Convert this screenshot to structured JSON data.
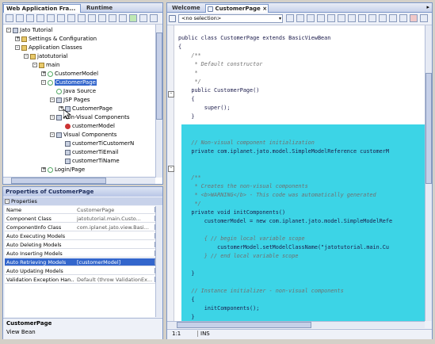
{
  "left_panel": {
    "tabs": [
      {
        "label": "Web Application Fra...",
        "active": true
      },
      {
        "label": "Runtime",
        "active": false
      }
    ],
    "tree": [
      {
        "label": "Jato Tutorial",
        "depth": 0,
        "icon": "project-icon",
        "expander": "-"
      },
      {
        "label": "Settings & Configuration",
        "depth": 1,
        "icon": "folder-icon",
        "expander": "+"
      },
      {
        "label": "Application Classes",
        "depth": 1,
        "icon": "folder-icon",
        "expander": "-"
      },
      {
        "label": "jatotutorial",
        "depth": 2,
        "icon": "package-icon",
        "expander": "-"
      },
      {
        "label": "main",
        "depth": 3,
        "icon": "package-icon",
        "expander": "-"
      },
      {
        "label": "CustomerModel",
        "depth": 4,
        "icon": "class-icon",
        "expander": "+"
      },
      {
        "label": "CustomerPage",
        "depth": 4,
        "icon": "class-icon",
        "expander": "-",
        "selected": true
      },
      {
        "label": "Java Source",
        "depth": 5,
        "icon": "source-icon",
        "expander": ""
      },
      {
        "label": "JSP Pages",
        "depth": 5,
        "icon": "group-icon",
        "expander": "-"
      },
      {
        "label": "CustomerPage",
        "depth": 6,
        "icon": "jsp-icon",
        "expander": "+"
      },
      {
        "label": "Non-Visual Components",
        "depth": 5,
        "icon": "group-icon",
        "expander": "-"
      },
      {
        "label": "customerModel",
        "depth": 6,
        "icon": "bean-icon",
        "expander": ""
      },
      {
        "label": "Visual Components",
        "depth": 5,
        "icon": "group-icon",
        "expander": "-"
      },
      {
        "label": "customerTiCustomerN",
        "depth": 6,
        "icon": "field-icon",
        "expander": ""
      },
      {
        "label": "customerTiEmail",
        "depth": 6,
        "icon": "field-icon",
        "expander": ""
      },
      {
        "label": "customerTiName",
        "depth": 6,
        "icon": "field-icon",
        "expander": ""
      },
      {
        "label": "Login/Page",
        "depth": 4,
        "icon": "class-icon",
        "expander": "+"
      }
    ]
  },
  "properties": {
    "title": "Properties of CustomerPage",
    "section": "Properties",
    "rows": [
      {
        "name": "Name",
        "value": "CustomerPage"
      },
      {
        "name": "Component Class",
        "value": "jatotutorial.main.Custo..."
      },
      {
        "name": "ComponentInfo Class",
        "value": "com.iplanet.jato.view.Basi..."
      },
      {
        "name": "Auto Executing Models",
        "value": ""
      },
      {
        "name": "Auto Deleting Models",
        "value": ""
      },
      {
        "name": "Auto Inserting Models",
        "value": ""
      },
      {
        "name": "Auto Retrieving Models",
        "value": "[customerModel]",
        "selected": true
      },
      {
        "name": "Auto Updating Models",
        "value": ""
      },
      {
        "name": "Validation Exception Han...",
        "value": "Default (throw ValidationEx..."
      }
    ],
    "footer_title": "CustomerPage",
    "footer_sub": "View Bean"
  },
  "editor": {
    "tabs": [
      {
        "label": "Welcome",
        "active": false
      },
      {
        "label": "CustomerPage",
        "active": true
      }
    ],
    "selector_value": "<no selection>",
    "code": [
      {
        "text": "public class CustomerPage extends BasicViewBean",
        "type": "code"
      },
      {
        "text": "{",
        "type": "code"
      },
      {
        "text": "    /**",
        "type": "comment"
      },
      {
        "text": "     * Default constructor",
        "type": "comment"
      },
      {
        "text": "     *",
        "type": "comment"
      },
      {
        "text": "     */",
        "type": "comment"
      },
      {
        "text": "    public CustomerPage()",
        "type": "code"
      },
      {
        "text": "    {",
        "type": "code"
      },
      {
        "text": "        super();",
        "type": "code"
      },
      {
        "text": "    }",
        "type": "code"
      },
      {
        "text": "",
        "type": "code"
      },
      {
        "text": "",
        "type": "code"
      },
      {
        "text": "    // Non-visual component initialization",
        "type": "comment"
      },
      {
        "text": "    private com.iplanet.jato.model.SimpleModelReference customerM",
        "type": "code"
      },
      {
        "text": "",
        "type": "code"
      },
      {
        "text": "",
        "type": "code"
      },
      {
        "text": "    /**",
        "type": "comment"
      },
      {
        "text": "     * Creates the non-visual components",
        "type": "comment"
      },
      {
        "text": "     * <b>WARNING</b> - This code was automatically generated",
        "type": "comment"
      },
      {
        "text": "     */",
        "type": "comment"
      },
      {
        "text": "    private void initComponents()",
        "type": "code"
      },
      {
        "text": "        customerModel = new com.iplanet.jato.model.SimpleModelRefe",
        "type": "code"
      },
      {
        "text": "",
        "type": "code"
      },
      {
        "text": "        { // begin local variable scope",
        "type": "comment"
      },
      {
        "text": "            customerModel.setModelClassName(\"jatotutorial.main.Cu",
        "type": "code"
      },
      {
        "text": "        } // end local variable scope",
        "type": "comment"
      },
      {
        "text": "",
        "type": "code"
      },
      {
        "text": "    }",
        "type": "code"
      },
      {
        "text": "",
        "type": "code"
      },
      {
        "text": "    // Instance initializer - non-visual components",
        "type": "comment"
      },
      {
        "text": "    {",
        "type": "code"
      },
      {
        "text": "        initComponents();",
        "type": "code"
      },
      {
        "text": "    }",
        "type": "code"
      }
    ],
    "status_position": "1:1",
    "status_mode": "INS"
  }
}
